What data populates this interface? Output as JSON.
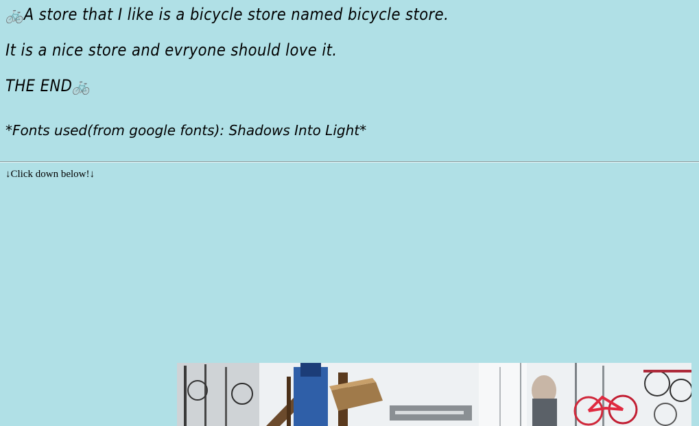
{
  "story": {
    "line1_icon": "🚲",
    "line1_text": "A store that I like is a bicycle store named bicycle store.",
    "line2_text": "It is a nice store and evryone should love it.",
    "line3_text": "THE END",
    "line3_icon": "🚲"
  },
  "fonts_note": "*Fonts used(from google fonts): Shadows Into Light*",
  "click_prompt": {
    "arrow_left": "↓",
    "text": "Click down below!",
    "arrow_right": "↓"
  },
  "photo": {
    "subject": "bicycle store interior with bicycles and store signage"
  }
}
